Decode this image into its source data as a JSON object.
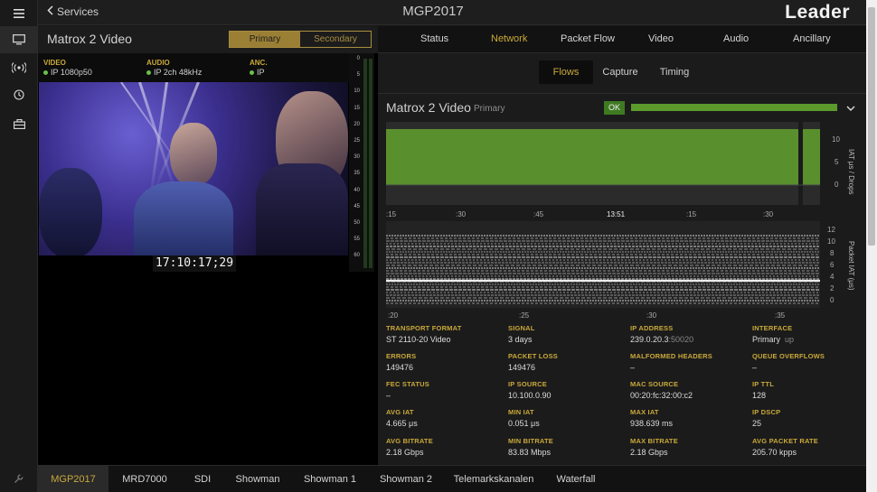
{
  "header": {
    "back_label": "Services",
    "title": "MGP2017",
    "logo": "Leader"
  },
  "rail": {
    "icons": [
      "menu-icon",
      "monitor-icon",
      "broadcast-icon",
      "clock-icon",
      "toolbox-icon",
      "wrench-icon"
    ]
  },
  "service": {
    "name": "Matrox 2 Video",
    "segments": {
      "primary": "Primary",
      "secondary": "Secondary"
    },
    "meta": [
      {
        "key": "VIDEO",
        "value": "IP 1080p50"
      },
      {
        "key": "AUDIO",
        "value": "IP 2ch 48kHz"
      },
      {
        "key": "ANC.",
        "value": "IP"
      }
    ],
    "timecode": "17:10:17;29",
    "meter_ticks": [
      "0",
      "5",
      "10",
      "15",
      "20",
      "25",
      "30",
      "35",
      "40",
      "45",
      "50",
      "55",
      "60"
    ]
  },
  "tabs": [
    "Status",
    "Network",
    "Packet Flow",
    "Video",
    "Audio",
    "Ancillary"
  ],
  "active_tab": "Network",
  "subtabs": [
    "Flows",
    "Capture",
    "Timing"
  ],
  "active_subtab": "Flows",
  "flow": {
    "name": "Matrox 2 Video",
    "role": "Primary",
    "status": "OK",
    "chart1": {
      "y_ticks": [
        "10",
        "5",
        "0"
      ],
      "ylabel": "IAT μs / Drops",
      "x_ticks": [
        ":15",
        ":30",
        ":45",
        "13:51",
        ":15",
        ":30"
      ]
    },
    "chart2": {
      "y_ticks": [
        "12",
        "10",
        "8",
        "6",
        "4",
        "2",
        "0"
      ],
      "ylabel": "Packet IAT (μs)",
      "x_ticks": [
        ":20",
        ":25",
        ":30",
        ":35"
      ]
    }
  },
  "stats": [
    {
      "key": "TRANSPORT FORMAT",
      "value": "ST 2110-20 Video"
    },
    {
      "key": "SIGNAL",
      "value": "3 days"
    },
    {
      "key": "IP ADDRESS",
      "value": "239.0.20.3",
      "extra": ":50020"
    },
    {
      "key": "INTERFACE",
      "value": "Primary",
      "extra": "up"
    },
    {
      "key": "ERRORS",
      "value": "149476"
    },
    {
      "key": "PACKET LOSS",
      "value": "149476"
    },
    {
      "key": "MALFORMED HEADERS",
      "value": "–"
    },
    {
      "key": "QUEUE OVERFLOWS",
      "value": "–"
    },
    {
      "key": "FEC STATUS",
      "value": "–"
    },
    {
      "key": "IP SOURCE",
      "value": "10.100.0.90"
    },
    {
      "key": "MAC SOURCE",
      "value": "00:20:fc:32:00:c2"
    },
    {
      "key": "IP TTL",
      "value": "128"
    },
    {
      "key": "AVG IAT",
      "value": "4.665 μs"
    },
    {
      "key": "MIN IAT",
      "value": "0.051 μs"
    },
    {
      "key": "MAX IAT",
      "value": "938.639 ms"
    },
    {
      "key": "IP DSCP",
      "value": "25"
    },
    {
      "key": "AVG BITRATE",
      "value": "2.18 Gbps"
    },
    {
      "key": "MIN BITRATE",
      "value": "83.83 Mbps"
    },
    {
      "key": "MAX BITRATE",
      "value": "2.18 Gbps"
    },
    {
      "key": "AVG PACKET RATE",
      "value": "205.70 kpps"
    }
  ],
  "bottom_tabs": [
    "MGP2017",
    "MRD7000",
    "SDI",
    "Showman",
    "Showman 1",
    "Showman 2",
    "Telemarkskanalen",
    "Waterfall"
  ],
  "active_bottom_tab": "MGP2017",
  "colors": {
    "accent": "#c9a93a",
    "ok": "#3e7a22",
    "chart": "#5c9a2c"
  }
}
